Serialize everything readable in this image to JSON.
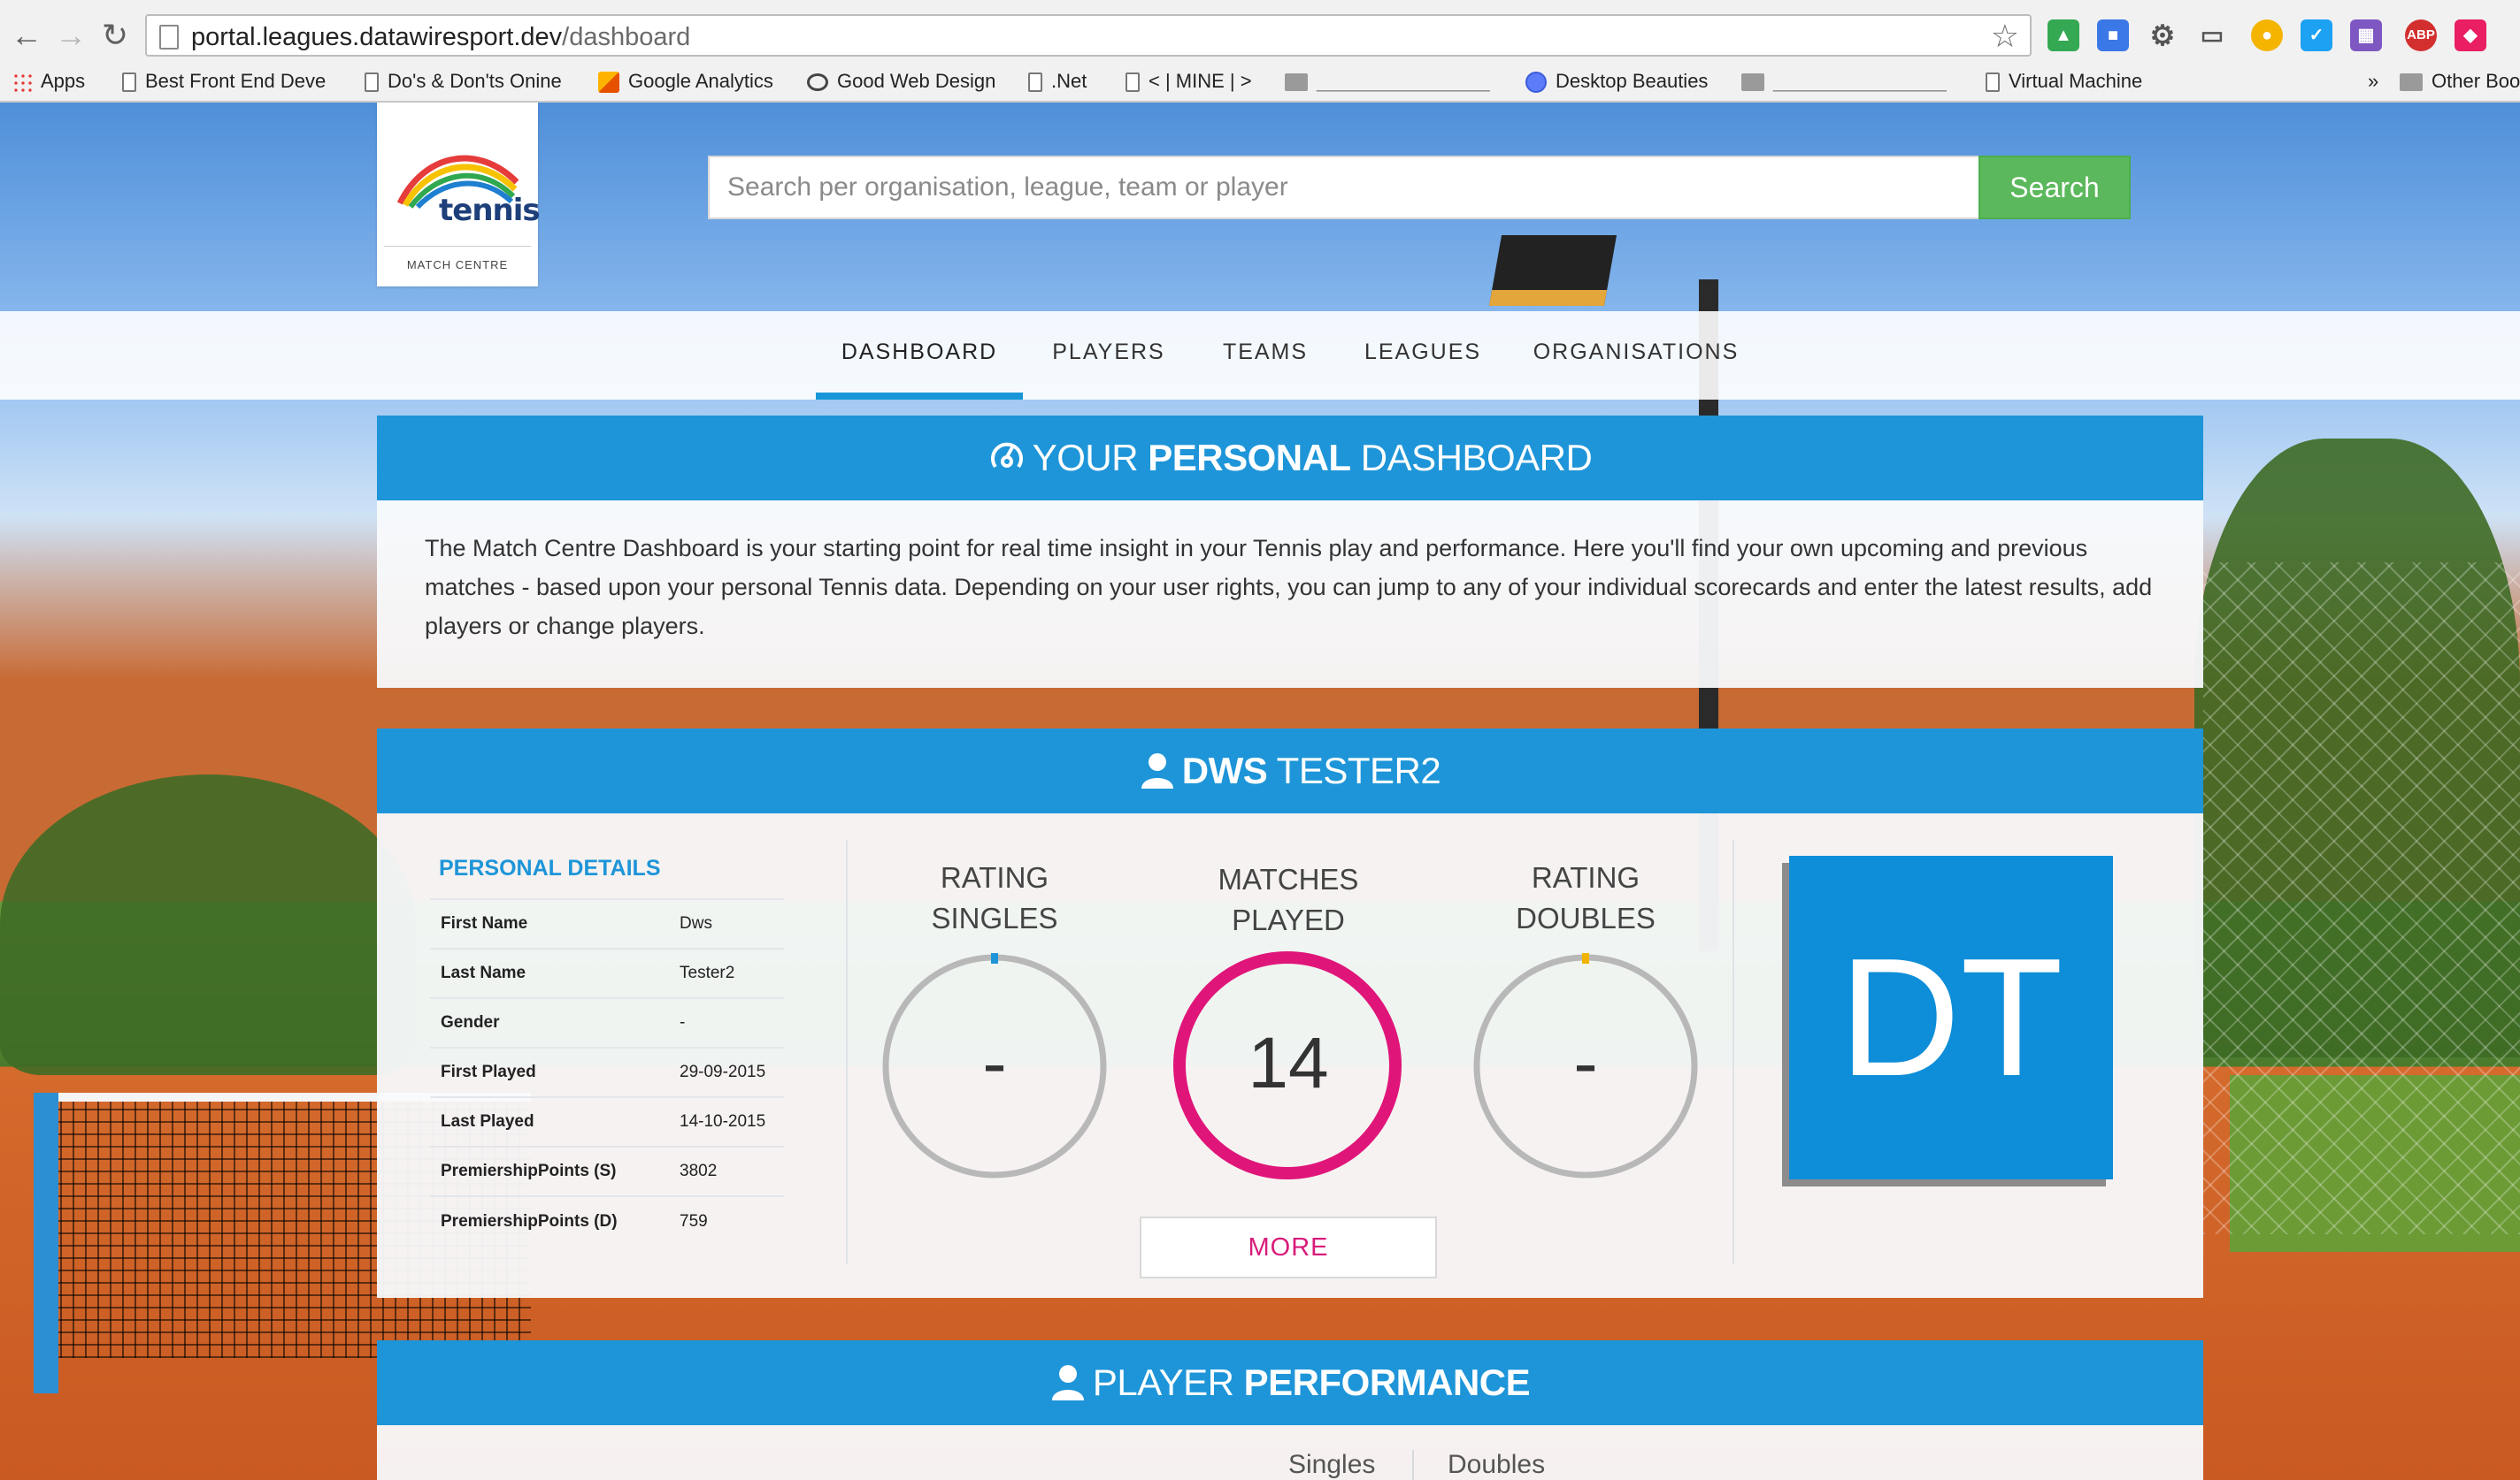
{
  "browser": {
    "url_host": "portal.leagues.datawiresport.dev",
    "url_path": "/dashboard",
    "bookmarks": [
      {
        "label": "Apps",
        "icon": "apps-icon"
      },
      {
        "label": "Best Front End Deve",
        "icon": "page-icon"
      },
      {
        "label": "Do's & Don'ts Onine",
        "icon": "page-icon"
      },
      {
        "label": "Google Analytics",
        "icon": "analytics-icon"
      },
      {
        "label": "Good Web Design",
        "icon": "eye-icon"
      },
      {
        "label": ".Net",
        "icon": "page-icon"
      },
      {
        "label": "< | MINE | >",
        "icon": "page-icon"
      },
      {
        "label": "________________",
        "icon": "folder-icon"
      },
      {
        "label": "Desktop Beauties",
        "icon": "globe-icon"
      },
      {
        "label": "________________",
        "icon": "folder-icon"
      },
      {
        "label": "Virtual Machine",
        "icon": "page-icon"
      },
      {
        "label": "»",
        "icon": ""
      },
      {
        "label": "Other Boo",
        "icon": "folder-icon"
      }
    ]
  },
  "site": {
    "logo": {
      "text": "tennis",
      "subtitle": "MATCH CENTRE"
    },
    "search": {
      "placeholder": "Search per organisation, league, team or player",
      "button": "Search"
    },
    "nav": [
      "DASHBOARD",
      "PLAYERS",
      "TEAMS",
      "LEAGUES",
      "ORGANISATIONS"
    ],
    "nav_active": "DASHBOARD"
  },
  "dashboard_panel": {
    "title_pre": "YOUR ",
    "title_bold": "PERSONAL",
    "title_post": " DASHBOARD",
    "intro": "The Match Centre Dashboard is your starting point for real time insight in your Tennis play and performance. Here you'll find your own upcoming and previous matches - based upon your personal Tennis data. Depending on your user rights, you can jump to any of your individual scorecards and enter the latest results, add players or change players."
  },
  "player_panel": {
    "title_bold": "DWS",
    "title_rest": " TESTER2",
    "details_title": "PERSONAL DETAILS",
    "details": [
      {
        "label": "First Name",
        "value": "Dws"
      },
      {
        "label": "Last Name",
        "value": "Tester2"
      },
      {
        "label": "Gender",
        "value": "-"
      },
      {
        "label": "First Played",
        "value": "29-09-2015"
      },
      {
        "label": "Last Played",
        "value": "14-10-2015"
      },
      {
        "label": "PremiershipPoints (S)",
        "value": "3802"
      },
      {
        "label": "PremiershipPoints (D)",
        "value": "759"
      }
    ],
    "stats": [
      {
        "label_1": "RATING",
        "label_2": "SINGLES",
        "value": "-",
        "ring_color": "#b8b8b8",
        "marker_color": "#1e95d8"
      },
      {
        "label_1": "MATCHES",
        "label_2": "PLAYED",
        "value": "14",
        "ring_color": "#e0157a",
        "marker_color": "#e0157a"
      },
      {
        "label_1": "RATING",
        "label_2": "DOUBLES",
        "value": "-",
        "ring_color": "#b8b8b8",
        "marker_color": "#f0b400"
      }
    ],
    "more_button": "MORE",
    "avatar_initials": "DT"
  },
  "performance_panel": {
    "title_pre": "PLAYER ",
    "title_bold": "PERFORMANCE",
    "tabs": [
      "Singles",
      "Doubles"
    ]
  },
  "colors": {
    "accent": "#1e95d8",
    "search_button": "#5cb85c",
    "matches_ring": "#e0157a",
    "avatar": "#0e8dd8"
  }
}
